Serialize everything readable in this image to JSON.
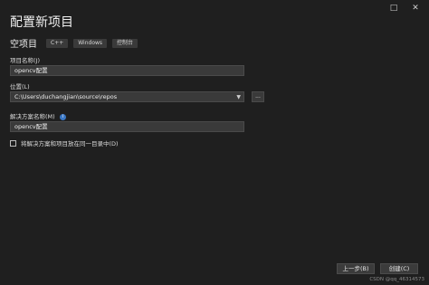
{
  "window": {
    "minimize_glyph": "□",
    "close_glyph": "✕"
  },
  "header": {
    "title": "配置新项目",
    "template_name": "空项目",
    "tags": [
      "C++",
      "Windows",
      "控制台"
    ]
  },
  "form": {
    "project_name_label": "项目名称(J)",
    "project_name_value": "opencv配置",
    "location_label": "位置(L)",
    "location_value": "C:\\Users\\duchangjian\\source\\repos",
    "browse_label": "...",
    "solution_name_label": "解决方案名称(M)",
    "solution_name_value": "opencv配置",
    "same_dir_checkbox_label": "将解决方案和项目放在同一目录中(D)",
    "same_dir_checked": false
  },
  "footer": {
    "back_label": "上一步(B)",
    "create_label": "创建(C)"
  },
  "watermark": "CSDN @qq_46314573"
}
